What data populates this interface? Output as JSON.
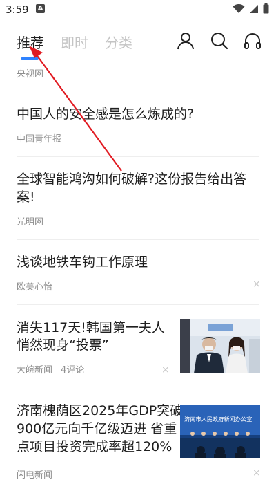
{
  "status_bar": {
    "time": "3:59",
    "badge": "A"
  },
  "nav": {
    "tabs": [
      {
        "label": "推荐",
        "active": true
      },
      {
        "label": "即时",
        "active": false
      },
      {
        "label": "分类",
        "active": false
      }
    ],
    "accent_color": "#2f83ff",
    "icons": [
      "user-icon",
      "search-icon",
      "headphones-icon"
    ]
  },
  "feed": [
    {
      "source": "央视网"
    },
    {
      "title": "中国人的安全感是怎么炼成的?",
      "source": "中国青年报"
    },
    {
      "title_line1": "全球智能鸿沟如何破解?这份报告给出答",
      "title_line2": "案!",
      "source": "光明网"
    },
    {
      "title": "浅谈地铁车钩工作原理",
      "source": "欧美心怡",
      "dismiss": "×"
    },
    {
      "title_line1": "消失117天!韩国第一夫人",
      "title_line2": "悄然现身“投票”",
      "source": "大皖新闻",
      "comments": "4评论",
      "dismiss": "×",
      "thumb": "thumb-photo-couple-voting"
    },
    {
      "title_line1": "济南槐荫区2025年GDP突破",
      "title_line2": "900亿元向千亿级迈进 省重",
      "title_line3": "点项目投资完成率超120%",
      "source": "闪电新闻",
      "dismiss": "×",
      "thumb": "thumb-photo-press-conference",
      "thumb_caption": "济南市人民政府新闻办公室"
    }
  ]
}
